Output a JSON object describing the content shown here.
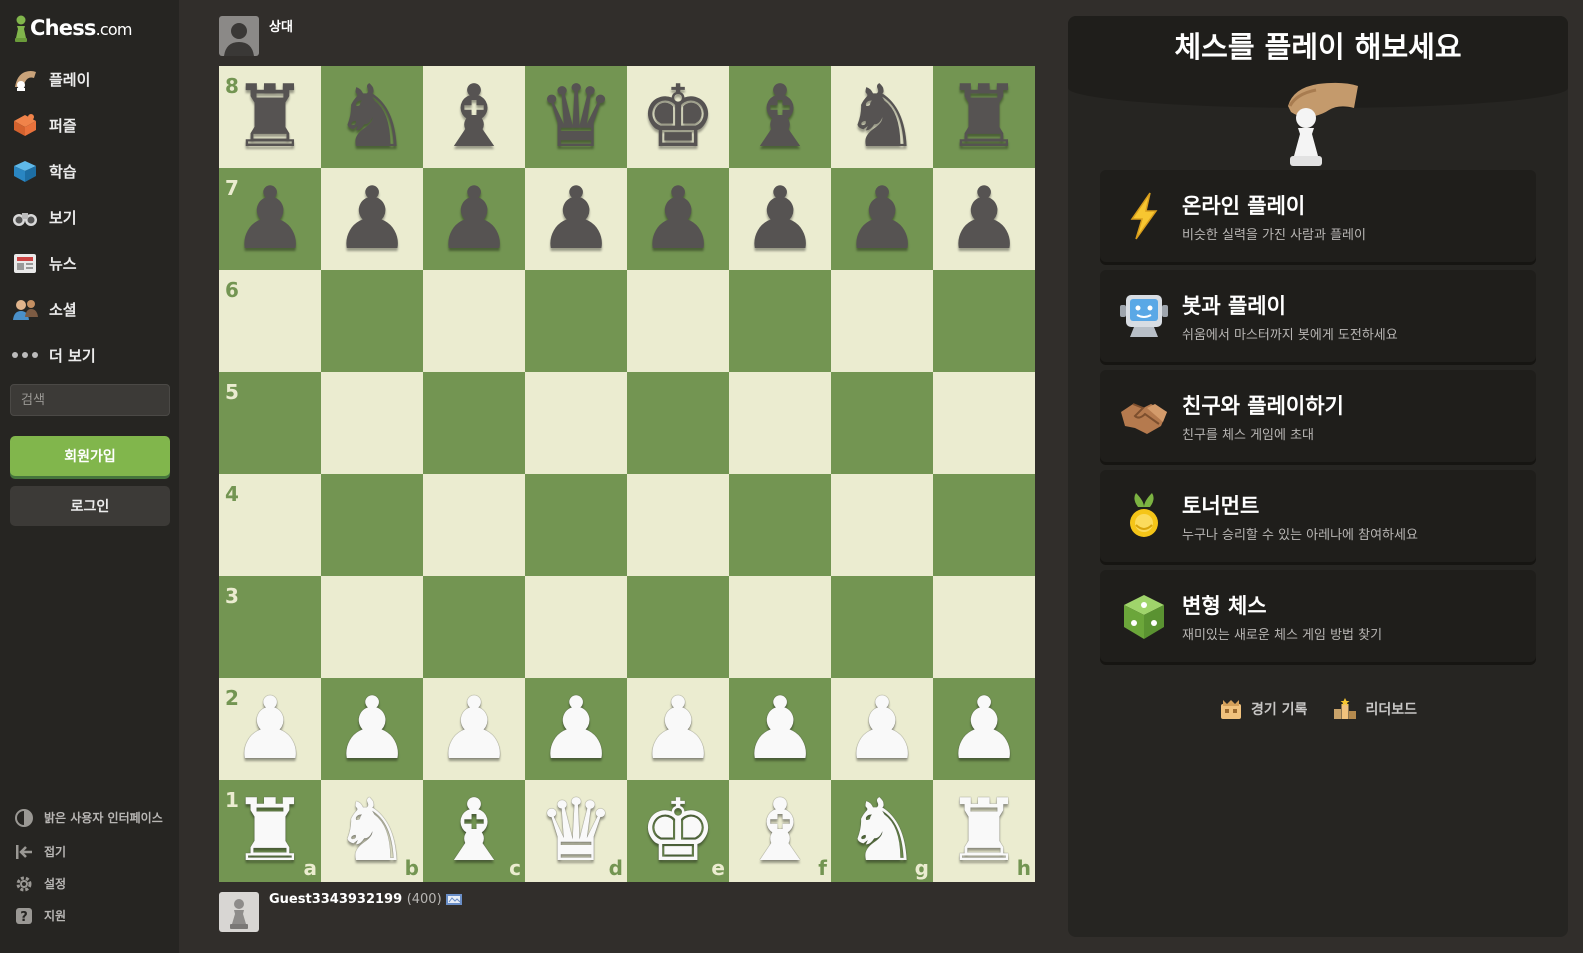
{
  "logo": {
    "name": "Chess",
    "domain": ".com"
  },
  "nav": [
    {
      "id": "play",
      "label": "플레이",
      "icon": "play-hand-icon"
    },
    {
      "id": "puzzles",
      "label": "퍼즐",
      "icon": "puzzle-icon"
    },
    {
      "id": "learn",
      "label": "학습",
      "icon": "learn-cube-icon"
    },
    {
      "id": "watch",
      "label": "보기",
      "icon": "binoculars-icon"
    },
    {
      "id": "news",
      "label": "뉴스",
      "icon": "newspaper-icon"
    },
    {
      "id": "social",
      "label": "소셜",
      "icon": "people-icon"
    },
    {
      "id": "more",
      "label": "더 보기",
      "icon": "more-dots-icon"
    }
  ],
  "search": {
    "placeholder": "검색"
  },
  "buttons": {
    "signup": "회원가입",
    "login": "로그인"
  },
  "bottom_nav": [
    {
      "id": "theme",
      "label": "밝은 사용자 인터페이스",
      "icon": "contrast-icon"
    },
    {
      "id": "collapse",
      "label": "접기",
      "icon": "collapse-arrow-icon"
    },
    {
      "id": "settings",
      "label": "설정",
      "icon": "gear-icon"
    },
    {
      "id": "support",
      "label": "지원",
      "icon": "help-icon"
    }
  ],
  "players": {
    "top": {
      "name": "상대"
    },
    "bottom": {
      "name": "Guest3343932199",
      "rating": "(400)"
    }
  },
  "board": {
    "ranks": [
      "8",
      "7",
      "6",
      "5",
      "4",
      "3",
      "2",
      "1"
    ],
    "files": [
      "a",
      "b",
      "c",
      "d",
      "e",
      "f",
      "g",
      "h"
    ],
    "position": [
      [
        "r",
        "n",
        "b",
        "q",
        "k",
        "b",
        "n",
        "r"
      ],
      [
        "p",
        "p",
        "p",
        "p",
        "p",
        "p",
        "p",
        "p"
      ],
      [
        "",
        "",
        "",
        "",
        "",
        "",
        "",
        ""
      ],
      [
        "",
        "",
        "",
        "",
        "",
        "",
        "",
        ""
      ],
      [
        "",
        "",
        "",
        "",
        "",
        "",
        "",
        ""
      ],
      [
        "",
        "",
        "",
        "",
        "",
        "",
        "",
        ""
      ],
      [
        "P",
        "P",
        "P",
        "P",
        "P",
        "P",
        "P",
        "P"
      ],
      [
        "R",
        "N",
        "B",
        "Q",
        "K",
        "B",
        "N",
        "R"
      ]
    ],
    "colors": {
      "light": "#ebecd0",
      "dark": "#739552"
    }
  },
  "panel": {
    "title": "체스를 플레이 해보세요",
    "options": [
      {
        "id": "online",
        "title": "온라인 플레이",
        "subtitle": "비슷한 실력을 가진 사람과 플레이",
        "icon": "lightning-icon"
      },
      {
        "id": "bots",
        "title": "봇과 플레이",
        "subtitle": "쉬움에서 마스터까지 봇에게 도전하세요",
        "icon": "robot-icon"
      },
      {
        "id": "friend",
        "title": "친구와 플레이하기",
        "subtitle": "친구를 체스 게임에 초대",
        "icon": "handshake-icon"
      },
      {
        "id": "tournament",
        "title": "토너먼트",
        "subtitle": "누구나 승리할 수 있는 아레나에 참여하세요",
        "icon": "medal-icon"
      },
      {
        "id": "variants",
        "title": "변형 체스",
        "subtitle": "재미있는 새로운 체스 게임 방법 찾기",
        "icon": "dice-icon"
      }
    ],
    "links": [
      {
        "id": "history",
        "label": "경기 기록",
        "icon": "history-icon"
      },
      {
        "id": "leaderboard",
        "label": "리더보드",
        "icon": "leaderboard-icon"
      }
    ]
  },
  "theme_colors": {
    "accent": "#81b64c",
    "background": "#312e2b",
    "sidebar": "#262522"
  }
}
